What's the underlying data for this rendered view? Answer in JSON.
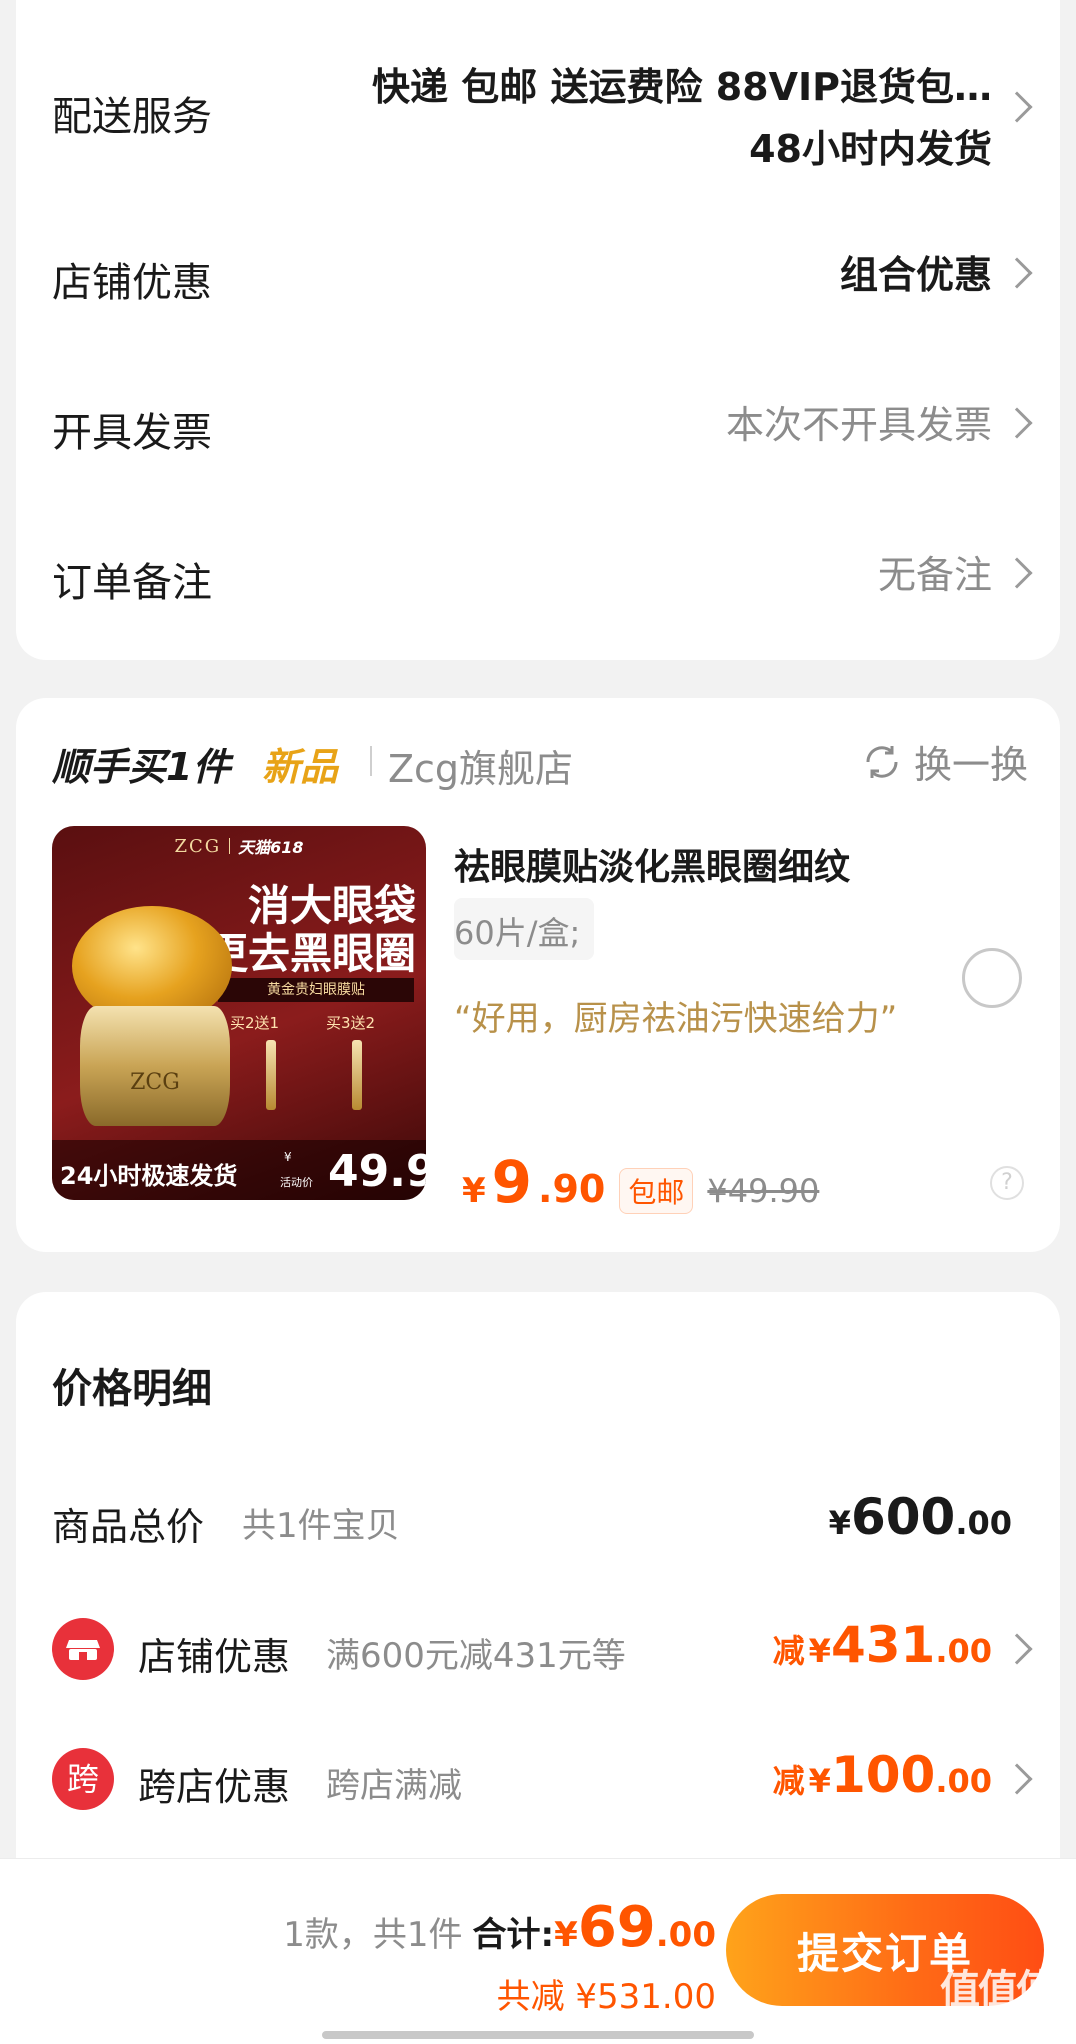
{
  "order_options": {
    "delivery": {
      "label": "配送服务",
      "value_line1": "快递 包邮 送运费险 88VIP退货包…",
      "value_line2": "48小时内发货"
    },
    "store_discount": {
      "label": "店铺优惠",
      "value": "组合优惠"
    },
    "invoice": {
      "label": "开具发票",
      "value": "本次不开具发票"
    },
    "note": {
      "label": "订单备注",
      "value": "无备注"
    }
  },
  "addon": {
    "title": "顺手买1件",
    "new_tag": "新品",
    "store": "Zcg旗舰店",
    "refresh_label": "换一换",
    "product": {
      "name": "祛眼膜贴淡化黑眼圈细纹",
      "spec": "60片/盒;",
      "review": "“好用，厨房祛油污快速给力”",
      "price_symbol": "¥",
      "price_int": "9",
      "price_dec": ".90",
      "shipping_tag": "包邮",
      "original_price": "¥49.90",
      "image": {
        "brand": "ZCG",
        "campaign": "天猫618",
        "headline1": "消大眼袋",
        "headline2": "更去黑眼圈",
        "sub": "黄金贵妇眼膜贴",
        "offer1": "买2送1",
        "offer2": "买3送2",
        "shipping": "24小时极速发货",
        "price_label": "活动价",
        "price_symbol": "¥",
        "price": "49.9"
      }
    }
  },
  "price_detail": {
    "title": "价格明细",
    "goods_total": {
      "label": "商品总价",
      "sub": "共1件宝贝",
      "symbol": "¥",
      "int": "600",
      "dec": ".00"
    },
    "store_discount": {
      "icon_text": "",
      "label": "店铺优惠",
      "sub": "满600元减431元等",
      "prefix": "减",
      "symbol": "¥",
      "int": "431",
      "dec": ".00"
    },
    "cross_store": {
      "icon_text": "跨",
      "label": "跨店优惠",
      "sub": "跨店满减",
      "prefix": "减",
      "symbol": "¥",
      "int": "100",
      "dec": ".00"
    }
  },
  "bottom": {
    "count_text": "1款，共1件",
    "total_label": "合计:",
    "total_symbol": "¥",
    "total_int": "69",
    "total_dec": ".00",
    "saved_text": "共减 ¥531.00",
    "submit_label": "提交订单"
  },
  "watermark": {
    "text": "值值值",
    "url": "zhizhizhi.com"
  },
  "colors": {
    "accent": "#ff5500",
    "button_gradient_start": "#ffa31a",
    "button_gradient_end": "#ff4d14",
    "review_text": "#b8914a",
    "new_tag": "#e8a317"
  }
}
